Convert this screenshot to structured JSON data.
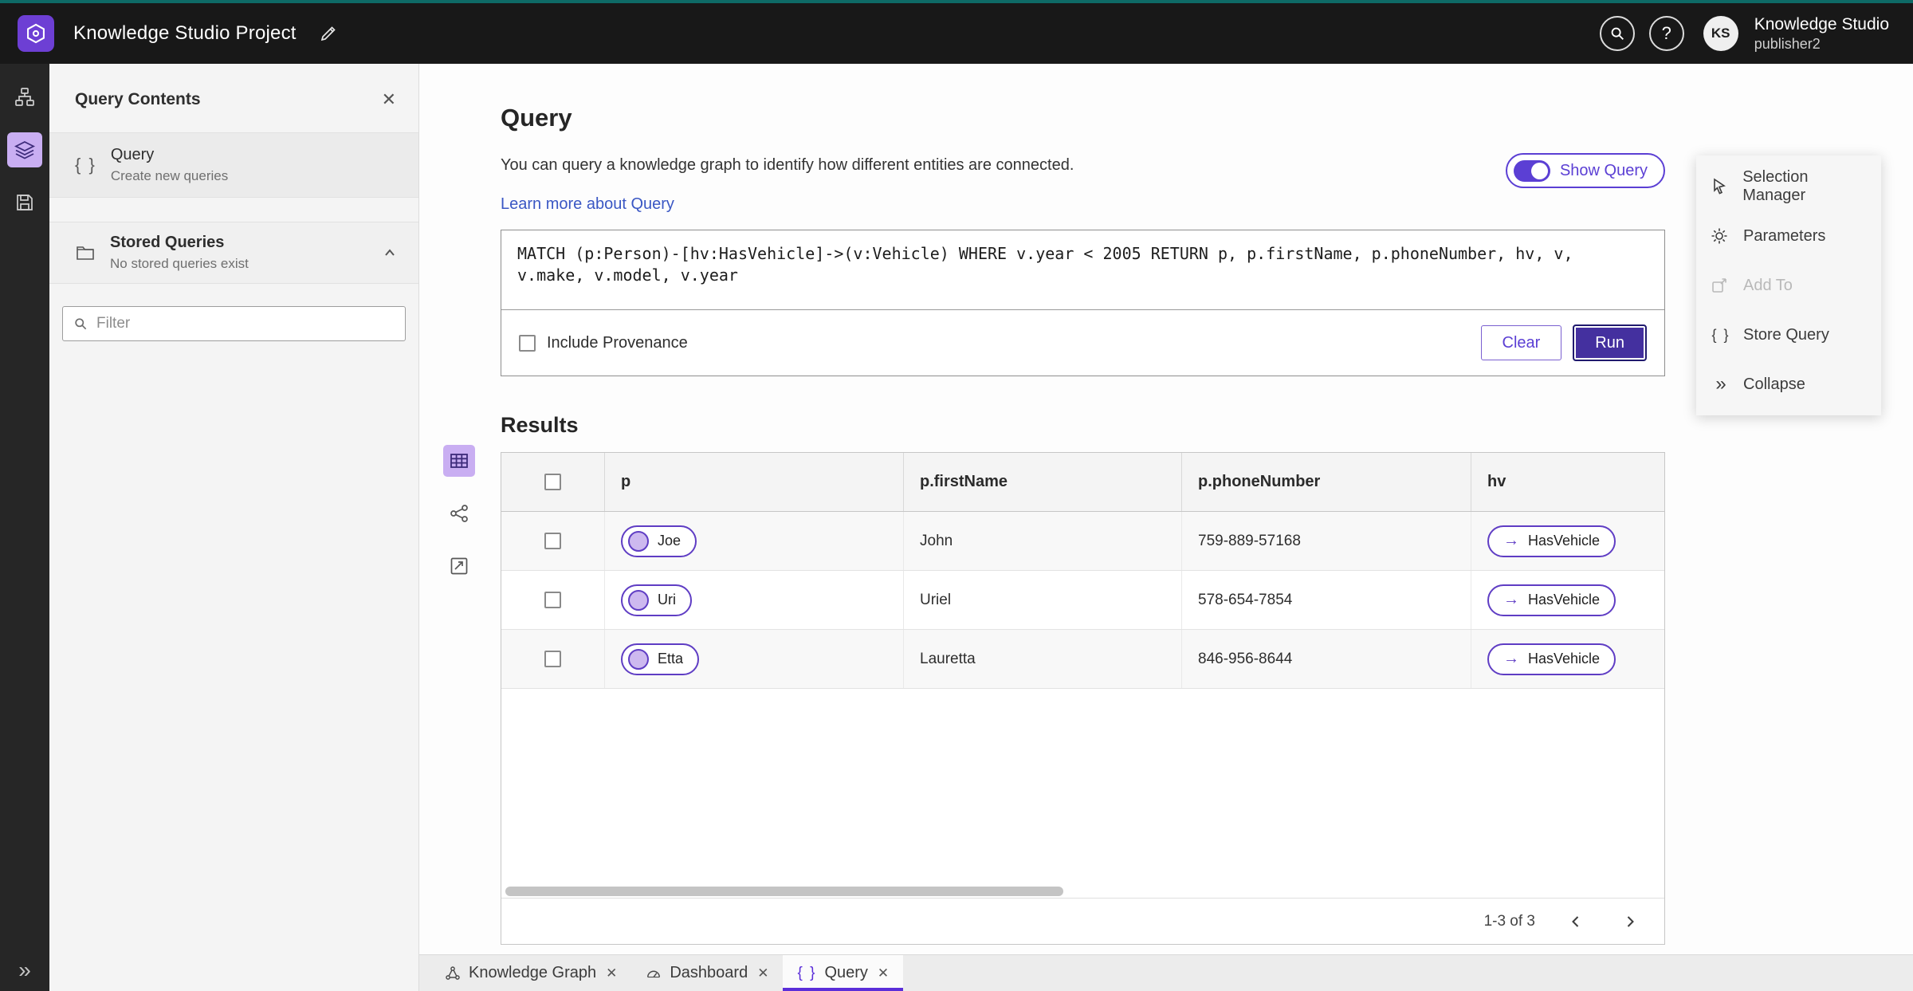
{
  "header": {
    "app_title": "Knowledge Studio Project",
    "product_name": "Knowledge Studio",
    "user_name": "publisher2",
    "avatar_initials": "KS"
  },
  "left_panel": {
    "title": "Query Contents",
    "query_item": {
      "title": "Query",
      "subtitle": "Create new queries"
    },
    "stored_queries": {
      "title": "Stored Queries",
      "subtitle": "No stored queries exist"
    },
    "filter_placeholder": "Filter"
  },
  "query_section": {
    "title": "Query",
    "description": "You can query a knowledge graph to identify how different entities are connected.",
    "learn_more": "Learn more about Query",
    "show_query": "Show Query",
    "query_text": "MATCH (p:Person)-[hv:HasVehicle]->(v:Vehicle) WHERE v.year < 2005 RETURN p, p.firstName, p.phoneNumber, hv, v, v.make, v.model, v.year",
    "include_provenance": "Include Provenance",
    "clear": "Clear",
    "run": "Run"
  },
  "results": {
    "title": "Results",
    "columns": [
      "p",
      "p.firstName",
      "p.phoneNumber",
      "hv"
    ],
    "rows": [
      {
        "p": "Joe",
        "firstName": "John",
        "phone": "759-889-57168",
        "hv": "HasVehicle"
      },
      {
        "p": "Uri",
        "firstName": "Uriel",
        "phone": "578-654-7854",
        "hv": "HasVehicle"
      },
      {
        "p": "Etta",
        "firstName": "Lauretta",
        "phone": "846-956-8644",
        "hv": "HasVehicle"
      }
    ],
    "pagination": "1-3 of 3"
  },
  "right_panel": {
    "items": [
      {
        "label": "Selection Manager"
      },
      {
        "label": "Parameters"
      },
      {
        "label": "Add To"
      },
      {
        "label": "Store Query"
      },
      {
        "label": "Collapse"
      }
    ]
  },
  "tabs": [
    {
      "label": "Knowledge Graph"
    },
    {
      "label": "Dashboard"
    },
    {
      "label": "Query"
    }
  ],
  "icons": {
    "close": "✕",
    "braces": "{ }",
    "arrow_right": "→",
    "chevrons_right": "»",
    "question": "?",
    "prev": "‹",
    "next": "›"
  },
  "colors": {
    "accent_purple": "#5b3fd4",
    "run_button": "#44309f",
    "topbar": "#181818",
    "teal_strip": "#0e6a66",
    "link_blue": "#3a57c4",
    "rail_selected_bg": "#c9aef2"
  }
}
